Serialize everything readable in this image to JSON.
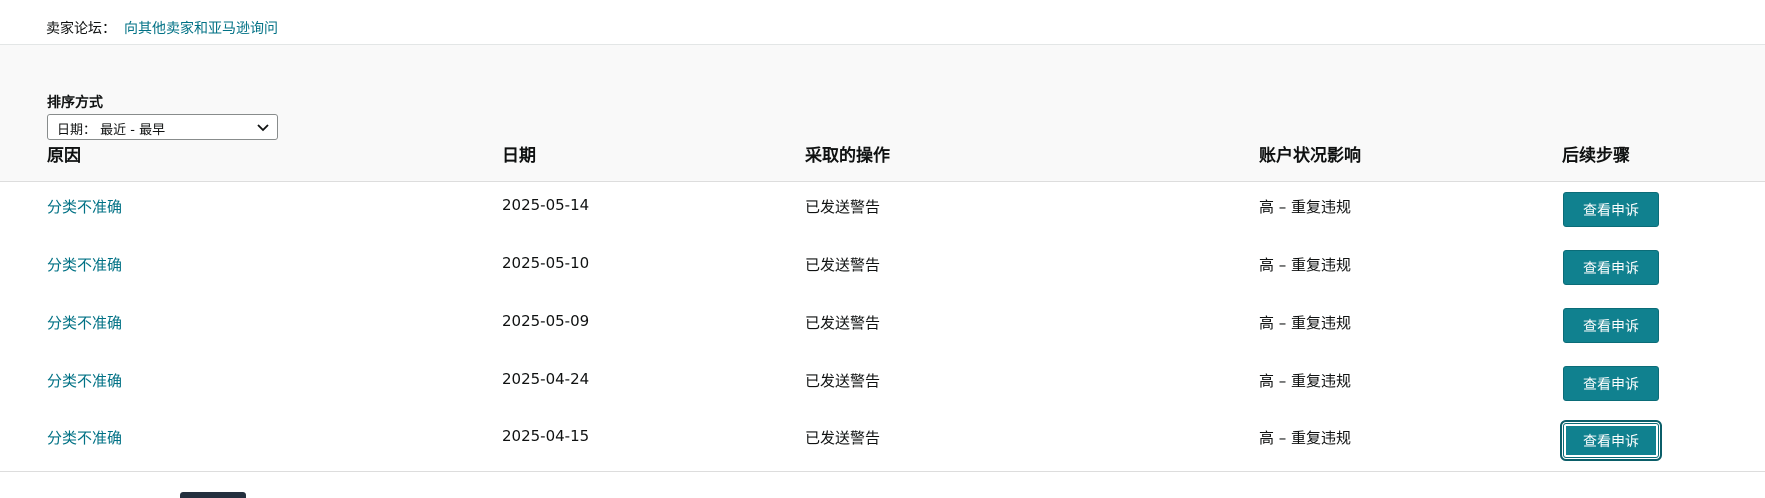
{
  "forum": {
    "label": "卖家论坛：",
    "link": "向其他卖家和亚马逊询问"
  },
  "sort": {
    "label": "排序方式",
    "selected": "日期：  最近 - 最早"
  },
  "columns": {
    "reason": "原因",
    "date": "日期",
    "action": "采取的操作",
    "impact": "账户状况影响",
    "next": "后续步骤"
  },
  "rows": [
    {
      "reason": "分类不准确",
      "date": "2025-05-14",
      "action": "已发送警告",
      "impact": "高 – 重复违规",
      "button": "查看申诉"
    },
    {
      "reason": "分类不准确",
      "date": "2025-05-10",
      "action": "已发送警告",
      "impact": "高 – 重复违规",
      "button": "查看申诉"
    },
    {
      "reason": "分类不准确",
      "date": "2025-05-09",
      "action": "已发送警告",
      "impact": "高 – 重复违规",
      "button": "查看申诉"
    },
    {
      "reason": "分类不准确",
      "date": "2025-04-24",
      "action": "已发送警告",
      "impact": "高 – 重复违规",
      "button": "查看申诉"
    },
    {
      "reason": "分类不准确",
      "date": "2025-04-15",
      "action": "已发送警告",
      "impact": "高 – 重复违规",
      "button": "查看申诉"
    }
  ],
  "colors": {
    "link": "#007185",
    "button": "#10818f",
    "header_bg": "#f9f9f9"
  }
}
